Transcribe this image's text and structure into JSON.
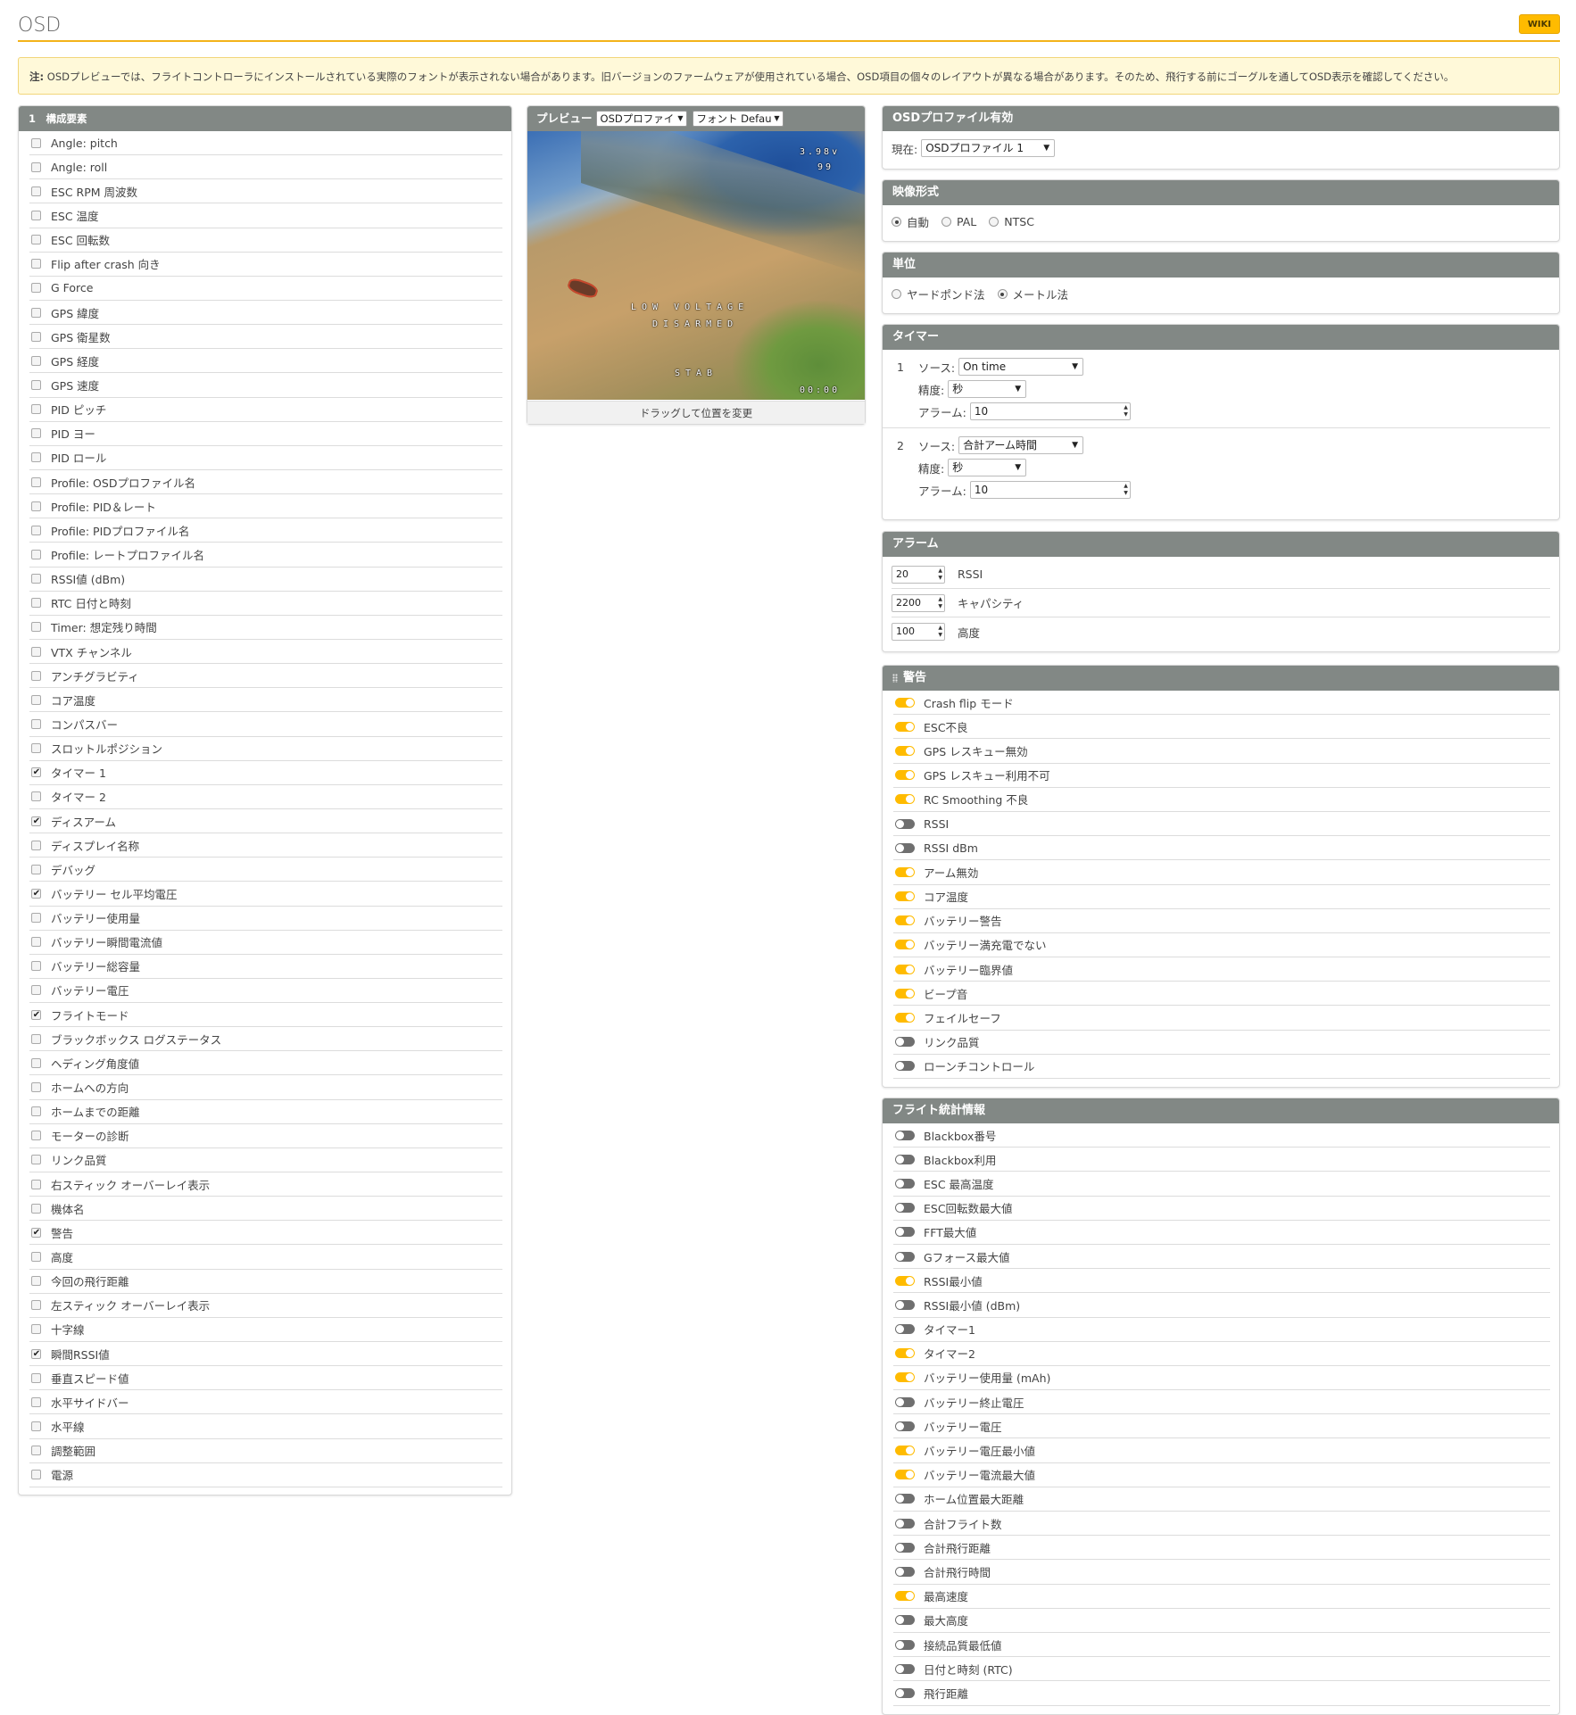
{
  "header": {
    "title": "OSD",
    "wiki_label": "WIKI"
  },
  "note": {
    "prefix": "注:",
    "text": " OSDプレビューでは、フライトコントローラにインストールされている実際のフォントが表示されない場合があります。旧バージョンのファームウェアが使用されている場合、OSD項目の個々のレイアウトが異なる場合があります。そのため、飛行する前にゴーグルを通してOSD表示を確認してください。"
  },
  "elements_panel": {
    "title": "1　構成要素",
    "items": [
      {
        "label": "Angle: pitch",
        "checked": false
      },
      {
        "label": "Angle: roll",
        "checked": false
      },
      {
        "label": "ESC RPM 周波数",
        "checked": false
      },
      {
        "label": "ESC 温度",
        "checked": false
      },
      {
        "label": "ESC 回転数",
        "checked": false
      },
      {
        "label": "Flip after crash 向き",
        "checked": false
      },
      {
        "label": "G Force",
        "checked": false
      },
      {
        "label": "GPS 緯度",
        "checked": false
      },
      {
        "label": "GPS 衛星数",
        "checked": false
      },
      {
        "label": "GPS 経度",
        "checked": false
      },
      {
        "label": "GPS 速度",
        "checked": false
      },
      {
        "label": "PID ピッチ",
        "checked": false
      },
      {
        "label": "PID ヨー",
        "checked": false
      },
      {
        "label": "PID ロール",
        "checked": false
      },
      {
        "label": "Profile: OSDプロファイル名",
        "checked": false
      },
      {
        "label": "Profile: PID＆レート",
        "checked": false
      },
      {
        "label": "Profile: PIDプロファイル名",
        "checked": false
      },
      {
        "label": "Profile: レートプロファイル名",
        "checked": false
      },
      {
        "label": "RSSI値 (dBm)",
        "checked": false
      },
      {
        "label": "RTC 日付と時刻",
        "checked": false
      },
      {
        "label": "Timer: 想定残り時間",
        "checked": false
      },
      {
        "label": "VTX チャンネル",
        "checked": false
      },
      {
        "label": "アンチグラビティ",
        "checked": false
      },
      {
        "label": "コア温度",
        "checked": false
      },
      {
        "label": "コンパスバー",
        "checked": false
      },
      {
        "label": "スロットルポジション",
        "checked": false
      },
      {
        "label": "タイマー 1",
        "checked": true
      },
      {
        "label": "タイマー 2",
        "checked": false
      },
      {
        "label": "ディスアーム",
        "checked": true
      },
      {
        "label": "ディスプレイ名称",
        "checked": false
      },
      {
        "label": "デバッグ",
        "checked": false
      },
      {
        "label": "バッテリー セル平均電圧",
        "checked": true
      },
      {
        "label": "バッテリー使用量",
        "checked": false
      },
      {
        "label": "バッテリー瞬間電流値",
        "checked": false
      },
      {
        "label": "バッテリー総容量",
        "checked": false
      },
      {
        "label": "バッテリー電圧",
        "checked": false
      },
      {
        "label": "フライトモード",
        "checked": true
      },
      {
        "label": "ブラックボックス ログステータス",
        "checked": false
      },
      {
        "label": "ヘディング角度値",
        "checked": false
      },
      {
        "label": "ホームへの方向",
        "checked": false
      },
      {
        "label": "ホームまでの距離",
        "checked": false
      },
      {
        "label": "モーターの診断",
        "checked": false
      },
      {
        "label": "リンク品質",
        "checked": false
      },
      {
        "label": "右スティック オーバーレイ表示",
        "checked": false
      },
      {
        "label": "機体名",
        "checked": false
      },
      {
        "label": "警告",
        "checked": true
      },
      {
        "label": "高度",
        "checked": false
      },
      {
        "label": "今回の飛行距離",
        "checked": false
      },
      {
        "label": "左スティック オーバーレイ表示",
        "checked": false
      },
      {
        "label": "十字線",
        "checked": false
      },
      {
        "label": "瞬間RSSI値",
        "checked": true
      },
      {
        "label": "垂直スピード値",
        "checked": false
      },
      {
        "label": "水平サイドバー",
        "checked": false
      },
      {
        "label": "水平線",
        "checked": false
      },
      {
        "label": "調整範囲",
        "checked": false
      },
      {
        "label": "電源",
        "checked": false
      }
    ]
  },
  "preview": {
    "label": "プレビュー",
    "profile_select": "OSDプロファイ",
    "font_select": "フォント Defau",
    "footer": "ドラッグして位置を変更",
    "osd": {
      "voltage": "3.98v",
      "rssi": "99",
      "warning": "LOW VOLTAGE",
      "disarmed": "DISARMED",
      "mode": "STAB",
      "timer": "00:00"
    }
  },
  "profile_panel": {
    "title": "OSDプロファイル有効",
    "current_label": "現在:",
    "current_value": "OSDプロファイル 1"
  },
  "video_panel": {
    "title": "映像形式",
    "options": [
      {
        "label": "自動",
        "selected": true
      },
      {
        "label": "PAL",
        "selected": false
      },
      {
        "label": "NTSC",
        "selected": false
      }
    ]
  },
  "units_panel": {
    "title": "単位",
    "options": [
      {
        "label": "ヤードポンド法",
        "selected": false
      },
      {
        "label": "メートル法",
        "selected": true
      }
    ]
  },
  "timers_panel": {
    "title": "タイマー",
    "source_label": "ソース:",
    "precision_label": "精度:",
    "alarm_label": "アラーム:",
    "timers": [
      {
        "index": "1",
        "source": "On time",
        "precision": "秒",
        "alarm": "10"
      },
      {
        "index": "2",
        "source": "合計アーム時間",
        "precision": "秒",
        "alarm": "10"
      }
    ]
  },
  "alarms_panel": {
    "title": "アラーム",
    "items": [
      {
        "value": "20",
        "label": "RSSI"
      },
      {
        "value": "2200",
        "label": "キャパシティ"
      },
      {
        "value": "100",
        "label": "高度"
      }
    ]
  },
  "warnings_panel": {
    "title": "警告",
    "items": [
      {
        "label": "Crash flip モード",
        "on": true
      },
      {
        "label": "ESC不良",
        "on": true
      },
      {
        "label": "GPS レスキュー無効",
        "on": true
      },
      {
        "label": "GPS レスキュー利用不可",
        "on": true
      },
      {
        "label": "RC Smoothing 不良",
        "on": true
      },
      {
        "label": "RSSI",
        "on": false
      },
      {
        "label": "RSSI dBm",
        "on": false
      },
      {
        "label": "アーム無効",
        "on": true
      },
      {
        "label": "コア温度",
        "on": true
      },
      {
        "label": "バッテリー警告",
        "on": true
      },
      {
        "label": "バッテリー満充電でない",
        "on": true
      },
      {
        "label": "バッテリー臨界値",
        "on": true
      },
      {
        "label": "ビープ音",
        "on": true
      },
      {
        "label": "フェイルセーフ",
        "on": true
      },
      {
        "label": "リンク品質",
        "on": false
      },
      {
        "label": "ローンチコントロール",
        "on": false
      }
    ]
  },
  "stats_panel": {
    "title": "フライト統計情報",
    "items": [
      {
        "label": "Blackbox番号",
        "on": false
      },
      {
        "label": "Blackbox利用",
        "on": false
      },
      {
        "label": "ESC 最高温度",
        "on": false
      },
      {
        "label": "ESC回転数最大値",
        "on": false
      },
      {
        "label": "FFT最大値",
        "on": false
      },
      {
        "label": "Gフォース最大値",
        "on": false
      },
      {
        "label": "RSSI最小値",
        "on": true
      },
      {
        "label": "RSSI最小値 (dBm)",
        "on": false
      },
      {
        "label": "タイマー1",
        "on": false
      },
      {
        "label": "タイマー2",
        "on": true
      },
      {
        "label": "バッテリー使用量 (mAh)",
        "on": true
      },
      {
        "label": "バッテリー終止電圧",
        "on": false
      },
      {
        "label": "バッテリー電圧",
        "on": false
      },
      {
        "label": "バッテリー電圧最小値",
        "on": true
      },
      {
        "label": "バッテリー電流最大値",
        "on": true
      },
      {
        "label": "ホーム位置最大距離",
        "on": false
      },
      {
        "label": "合計フライト数",
        "on": false
      },
      {
        "label": "合計飛行距離",
        "on": false
      },
      {
        "label": "合計飛行時間",
        "on": false
      },
      {
        "label": "最高速度",
        "on": true
      },
      {
        "label": "最大高度",
        "on": false
      },
      {
        "label": "接続品質最低値",
        "on": false
      },
      {
        "label": "日付と時刻 (RTC)",
        "on": false
      },
      {
        "label": "飛行距離",
        "on": false
      }
    ]
  },
  "colors": {
    "accent": "#ffbb00",
    "panel_header": "#828885",
    "note_bg": "#fff9d9"
  }
}
